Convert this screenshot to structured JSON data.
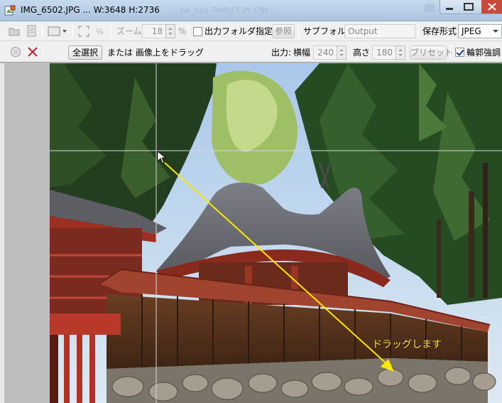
{
  "window": {
    "title": "IMG_6502.JPG ... W:3648 H:2736",
    "ghost_title": "... pe_saq .ReR(CF:Pt-CNt ..."
  },
  "toolbar1": {
    "zoom_label": "ズーム",
    "zoom_value": "18",
    "zoom_unit": "%",
    "output_folder_checkbox_label": "出力フォルダ指定",
    "output_folder_checked": false,
    "browse_button_label": "参照",
    "subfolder_label": "サブフォルダ",
    "subfolder_value": "Output",
    "save_format_label": "保存形式",
    "save_format_value": "JPEG"
  },
  "toolbar2": {
    "select_all_button_label": "全選択",
    "hint_text": "または 画像上をドラッグ",
    "output_label": "出力:",
    "width_label": "横幅",
    "width_value": "240",
    "height_label": "高さ",
    "height_value": "180",
    "preset_button_label": "プリセット",
    "outline_checkbox_label": "輪郭強調",
    "outline_checked": true
  },
  "canvas": {
    "drag_annotation": "ドラッグします",
    "arrow_color": "#ffe600",
    "crosshair_color": "#d0d0d0"
  },
  "colors": {
    "titlebar": "#b6cde6",
    "toolbar": "#f0f0f0",
    "side_panel": "#bdbdbd"
  }
}
